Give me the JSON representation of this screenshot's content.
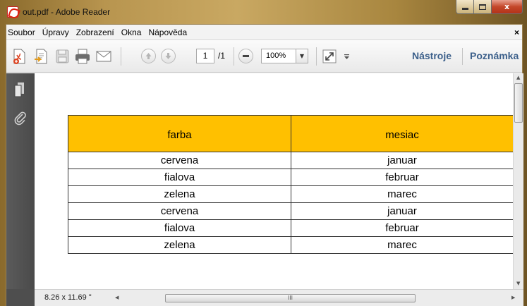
{
  "window": {
    "title": "out.pdf - Adobe Reader",
    "close_glyph": "x"
  },
  "menu": {
    "items": [
      "Soubor",
      "Úpravy",
      "Zobrazení",
      "Okna",
      "Nápověda"
    ],
    "close_glyph": "×"
  },
  "toolbar": {
    "icons": [
      "create-pdf-icon",
      "export-icon",
      "save-icon",
      "print-icon",
      "email-icon",
      "page-up-icon",
      "page-down-icon",
      "zoom-out-icon",
      "fit-page-icon"
    ],
    "page_current": "1",
    "page_total": "/1",
    "zoom": "100%",
    "tools_label": "Nástroje",
    "comment_label": "Poznámka"
  },
  "document": {
    "table": {
      "headers": [
        "farba",
        "mesiac"
      ],
      "rows": [
        [
          "cervena",
          "januar"
        ],
        [
          "fialova",
          "februar"
        ],
        [
          "zelena",
          "marec"
        ],
        [
          "cervena",
          "januar"
        ],
        [
          "fialova",
          "februar"
        ],
        [
          "zelena",
          "marec"
        ]
      ],
      "header_color": "#ffc000"
    }
  },
  "status": {
    "page_size": "8.26 x 11.69 \"",
    "scroll_grip": "III"
  }
}
